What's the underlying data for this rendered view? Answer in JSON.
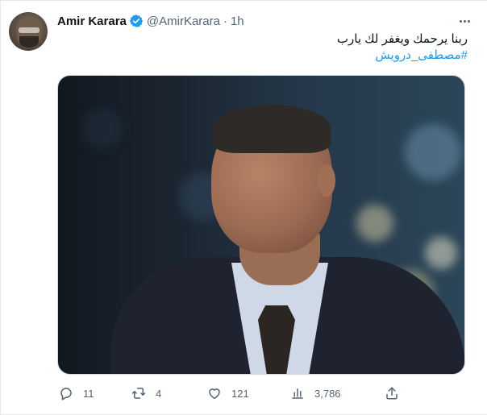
{
  "tweet": {
    "author": {
      "name": "Amir Karara",
      "handle": "@AmirKarara",
      "verified": true
    },
    "separator": "·",
    "time": "1h",
    "text_line_1": "ربنا يرحمك ويغفر لك يارب",
    "hashtag": "#مصطفى_درويش",
    "stats": {
      "replies": "11",
      "retweets": "4",
      "likes": "121",
      "views": "3,786"
    }
  },
  "colors": {
    "accent": "#1d9bf0",
    "text": "#0f1419",
    "muted": "#536471"
  },
  "icons": [
    "more-icon",
    "verified-badge-icon",
    "reply-icon",
    "retweet-icon",
    "like-icon",
    "views-icon",
    "share-icon"
  ]
}
